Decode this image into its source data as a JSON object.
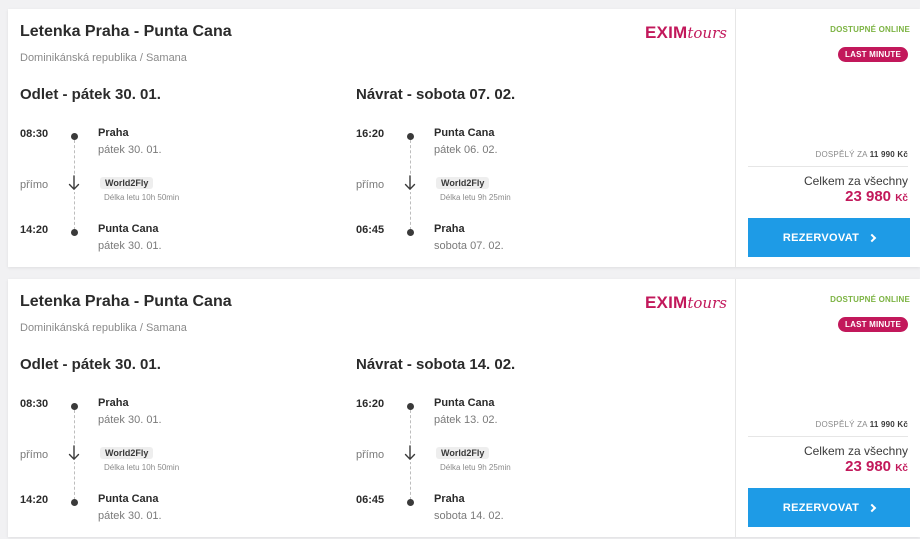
{
  "colors": {
    "brand": "#c2185b",
    "accent": "#1e9be6",
    "online": "#7cb342"
  },
  "icons": {
    "dot": "timeline-dot-icon",
    "arrow": "arrow-down-icon",
    "chevron": "chevron-right-icon"
  },
  "offers": [
    {
      "title": "Letenka Praha - Punta Cana",
      "subtitle": "Dominikánská republika / Samana",
      "logo_bold": "EXIM",
      "logo_script": "tours",
      "outbound": {
        "heading": "Odlet - pátek 30. 01.",
        "dep_time": "08:30",
        "dep_city": "Praha",
        "dep_date": "pátek 30. 01.",
        "direct": "přímo",
        "airline": "World2Fly",
        "duration": "Délka letu 10h 50min",
        "arr_time": "14:20",
        "arr_city": "Punta Cana",
        "arr_date": "pátek 30. 01."
      },
      "return": {
        "heading": "Návrat - sobota 07. 02.",
        "dep_time": "16:20",
        "dep_city": "Punta Cana",
        "dep_date": "pátek 06. 02.",
        "direct": "přímo",
        "airline": "World2Fly",
        "duration": "Délka letu 9h 25min",
        "arr_time": "06:45",
        "arr_city": "Praha",
        "arr_date": "sobota 07. 02."
      },
      "badge_online": "DOSTUPNÉ ONLINE",
      "badge_lastminute": "LAST MINUTE",
      "adult_label": "DOSPĚLÝ ZA",
      "adult_price": "11 990 Kč",
      "total_label": "Celkem za všechny",
      "total_price": "23 980",
      "currency": "Kč",
      "button": "REZERVOVAT"
    },
    {
      "title": "Letenka Praha - Punta Cana",
      "subtitle": "Dominikánská republika / Samana",
      "logo_bold": "EXIM",
      "logo_script": "tours",
      "outbound": {
        "heading": "Odlet - pátek 30. 01.",
        "dep_time": "08:30",
        "dep_city": "Praha",
        "dep_date": "pátek 30. 01.",
        "direct": "přímo",
        "airline": "World2Fly",
        "duration": "Délka letu 10h 50min",
        "arr_time": "14:20",
        "arr_city": "Punta Cana",
        "arr_date": "pátek 30. 01."
      },
      "return": {
        "heading": "Návrat - sobota 14. 02.",
        "dep_time": "16:20",
        "dep_city": "Punta Cana",
        "dep_date": "pátek 13. 02.",
        "direct": "přímo",
        "airline": "World2Fly",
        "duration": "Délka letu 9h 25min",
        "arr_time": "06:45",
        "arr_city": "Praha",
        "arr_date": "sobota 14. 02."
      },
      "badge_online": "DOSTUPNÉ ONLINE",
      "badge_lastminute": "LAST MINUTE",
      "adult_label": "DOSPĚLÝ ZA",
      "adult_price": "11 990 Kč",
      "total_label": "Celkem za všechny",
      "total_price": "23 980",
      "currency": "Kč",
      "button": "REZERVOVAT"
    }
  ]
}
